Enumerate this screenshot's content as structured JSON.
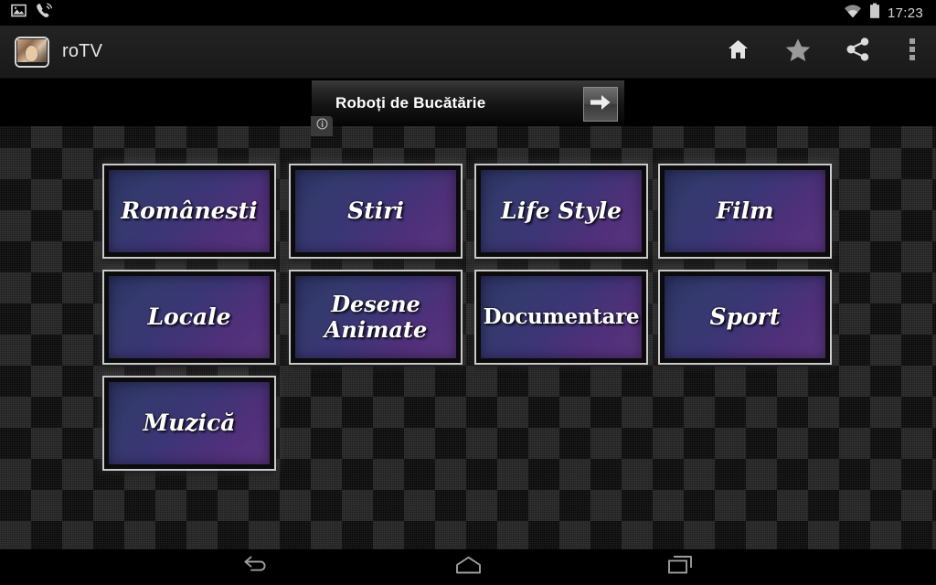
{
  "status_bar": {
    "left_icons": [
      {
        "name": "screenshot-icon",
        "label": "Screenshot"
      },
      {
        "name": "phone-call-icon",
        "label": "Call in progress"
      }
    ],
    "right_icons": [
      {
        "name": "wifi-icon",
        "label": "Wi-Fi"
      },
      {
        "name": "battery-icon",
        "label": "Battery"
      }
    ],
    "clock": "17:23"
  },
  "action_bar": {
    "app_icon": "retro-tv-app-icon",
    "title": "roTV",
    "actions": [
      {
        "name": "home-icon",
        "label": "Home"
      },
      {
        "name": "star-icon",
        "label": "Favorites"
      },
      {
        "name": "share-icon",
        "label": "Share"
      },
      {
        "name": "overflow-menu-icon",
        "label": "More options"
      }
    ]
  },
  "ad": {
    "text": "Roboți de Bucătărie",
    "cta_icon": "arrow-right-icon",
    "info_icon": "ad-info-icon",
    "info_label": "i"
  },
  "categories": [
    {
      "label": "Românesti",
      "style": "italic",
      "row": 0,
      "col": 0
    },
    {
      "label": "Stiri",
      "style": "italic",
      "row": 0,
      "col": 1
    },
    {
      "label": "Life Style",
      "style": "italic",
      "row": 0,
      "col": 2
    },
    {
      "label": "Film",
      "style": "italic",
      "row": 0,
      "col": 3
    },
    {
      "label": "Locale",
      "style": "italic",
      "row": 1,
      "col": 0
    },
    {
      "label": "Desene\nAnimate",
      "style": "italic-two-line",
      "row": 1,
      "col": 1
    },
    {
      "label": "Documentare",
      "style": "upright",
      "row": 1,
      "col": 2
    },
    {
      "label": "Sport",
      "style": "italic",
      "row": 1,
      "col": 3
    },
    {
      "label": "Muzică",
      "style": "italic",
      "row": 2,
      "col": 0
    }
  ],
  "nav_bar": [
    {
      "name": "back-icon",
      "label": "Back"
    },
    {
      "name": "home-icon",
      "label": "Home"
    },
    {
      "name": "recents-icon",
      "label": "Recent apps"
    }
  ],
  "colors": {
    "tile_gradient_start": "#2c3162",
    "tile_gradient_end": "#5a3580",
    "tile_border": "#c9c9c9",
    "action_bar_bg": "#1d1d1d",
    "background": "#0a0a0a",
    "text": "#ffffff"
  }
}
